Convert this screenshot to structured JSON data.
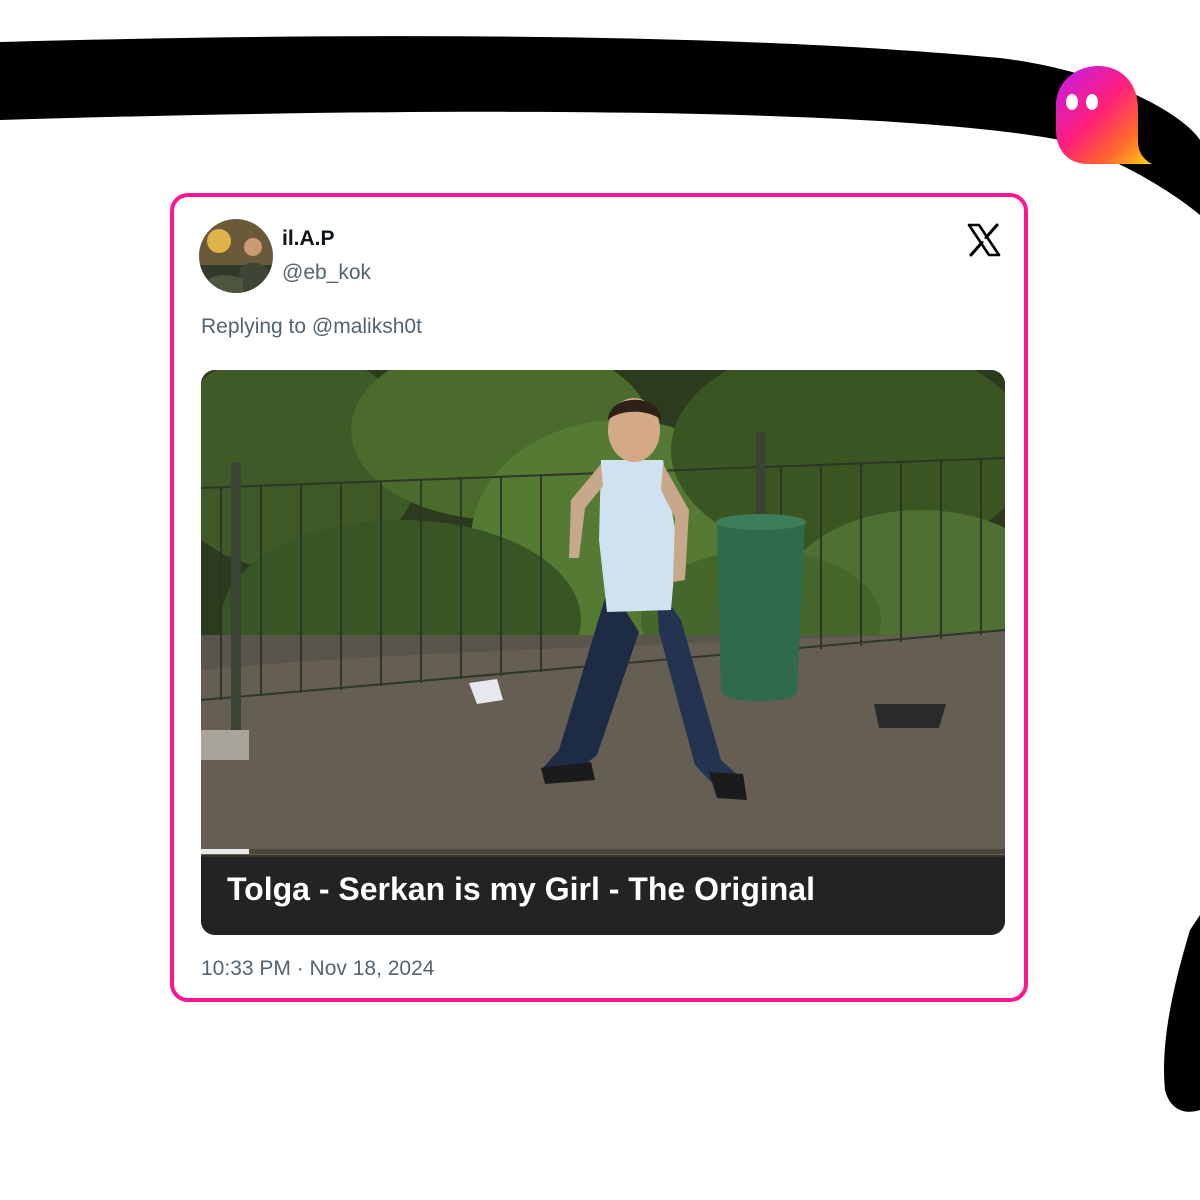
{
  "tweet": {
    "display_name": "il.A.P",
    "handle": "@eb_kok",
    "reply_prefix": "Replying to @maliksh0t",
    "media_title": "Tolga - Serkan is my Girl - The Original",
    "video_progress_percent": 6,
    "timestamp": "10:33 PM · Nov 18, 2024"
  },
  "icons": {
    "platform": "x-logo-icon",
    "brand": "ghost-logo-icon"
  },
  "colors": {
    "card_border": "#ff1493",
    "background_stroke": "#000000",
    "text_secondary": "#536471",
    "text_primary": "#0f1419"
  }
}
